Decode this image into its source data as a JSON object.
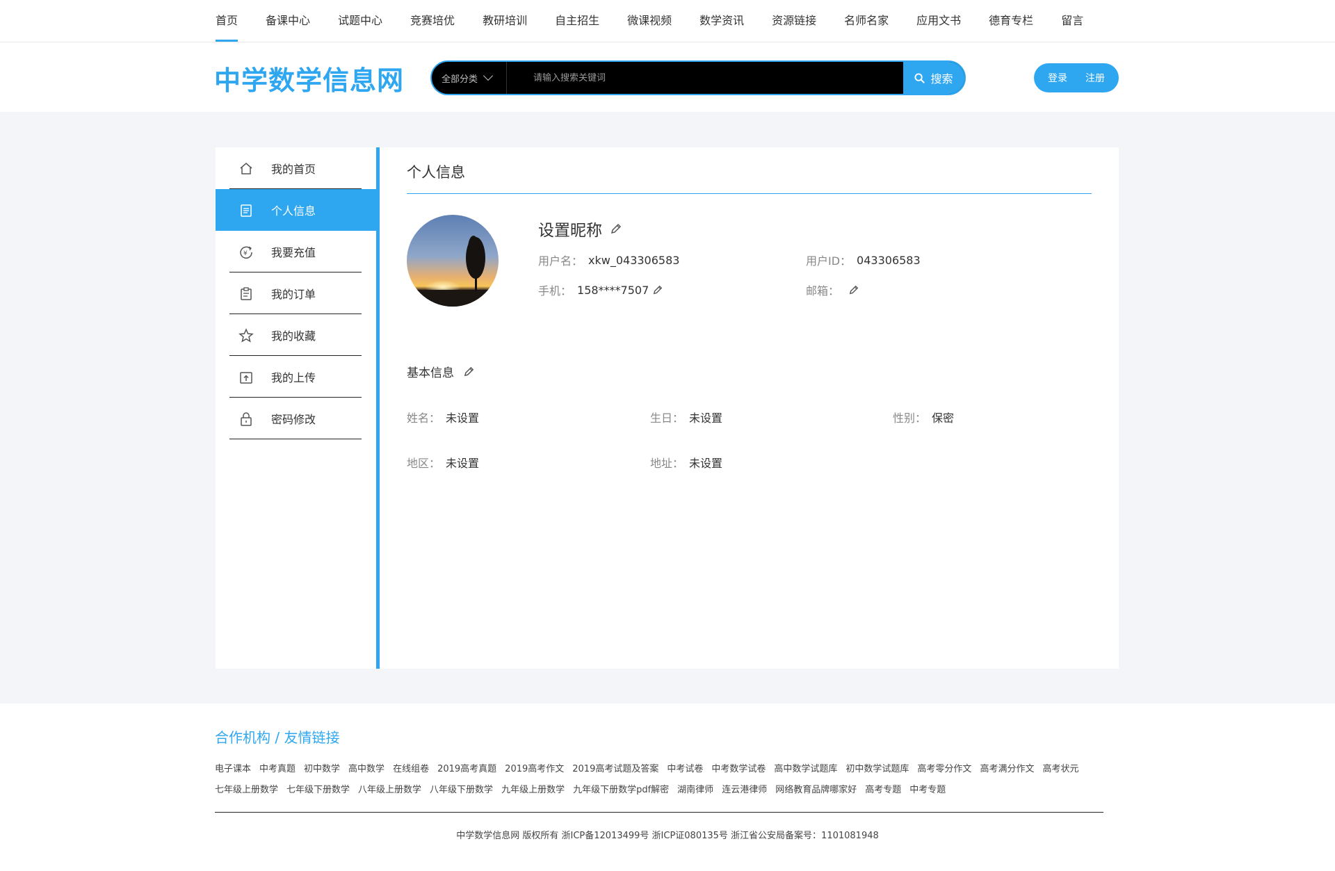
{
  "nav": {
    "items": [
      "首页",
      "备课中心",
      "试题中心",
      "竞赛培优",
      "教研培训",
      "自主招生",
      "微课视频",
      "数学资讯",
      "资源链接",
      "名师名家",
      "应用文书",
      "德育专栏",
      "留言"
    ],
    "active_index": 0
  },
  "header": {
    "logo": "中学数学信息网",
    "search": {
      "category": "全部分类",
      "placeholder": "请输入搜索关键词",
      "button": "搜索"
    },
    "login": "登录",
    "register": "注册"
  },
  "sidebar": {
    "items": [
      {
        "label": "我的首页",
        "icon": "home-icon"
      },
      {
        "label": "个人信息",
        "icon": "document-icon"
      },
      {
        "label": "我要充值",
        "icon": "recharge-icon"
      },
      {
        "label": "我的订单",
        "icon": "order-icon"
      },
      {
        "label": "我的收藏",
        "icon": "star-icon"
      },
      {
        "label": "我的上传",
        "icon": "upload-icon"
      },
      {
        "label": "密码修改",
        "icon": "lock-icon"
      }
    ],
    "active_index": 1
  },
  "profile": {
    "title": "个人信息",
    "nickname": "设置昵称",
    "username_label": "用户名：",
    "username": "xkw_043306583",
    "userid_label": "用户ID：",
    "userid": "043306583",
    "phone_label": "手机：",
    "phone": "158****7507",
    "email_label": "邮箱：",
    "email": ""
  },
  "basic": {
    "title": "基本信息",
    "fields": [
      {
        "label": "姓名：",
        "value": "未设置"
      },
      {
        "label": "生日：",
        "value": "未设置"
      },
      {
        "label": "性别：",
        "value": "保密"
      },
      {
        "label": "地区：",
        "value": "未设置"
      },
      {
        "label": "地址：",
        "value": "未设置"
      }
    ]
  },
  "footer": {
    "partner_title": "合作机构 / 友情链接",
    "links": [
      "电子课本",
      "中考真题",
      "初中数学",
      "高中数学",
      "在线组卷",
      "2019高考真题",
      "2019高考作文",
      "2019高考试题及答案",
      "中考试卷",
      "中考数学试卷",
      "高中数学试题库",
      "初中数学试题库",
      "高考零分作文",
      "高考满分作文",
      "高考状元",
      "七年级上册数学",
      "七年级下册数学",
      "八年级上册数学",
      "八年级下册数学",
      "九年级上册数学",
      "九年级下册数学pdf解密",
      "湖南律师",
      "连云港律师",
      "网络教育品牌哪家好",
      "高考专题",
      "中考专题"
    ],
    "copyright": "中学数学信息网  版权所有  浙ICP备12013499号  浙ICP证080135号  浙江省公安局备案号：1101081948"
  },
  "colors": {
    "accent": "#2fa7f0",
    "page_bg": "#f4f5f8"
  }
}
